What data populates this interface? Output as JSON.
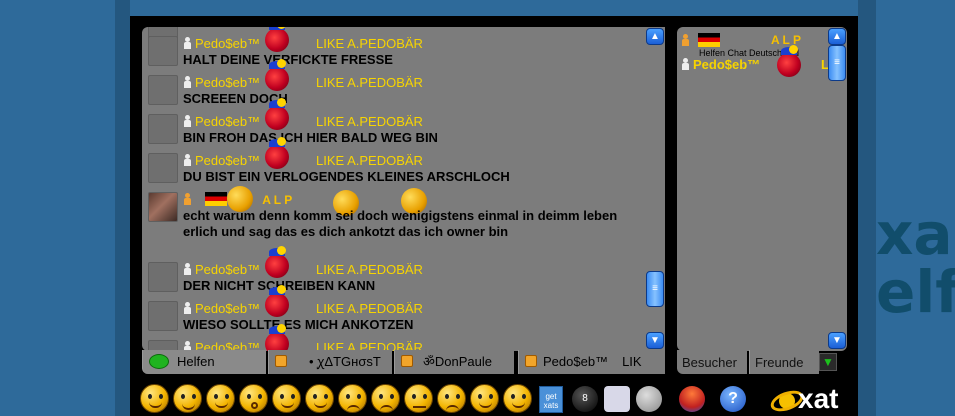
{
  "chat": {
    "messages": [
      {
        "user": "Pedo$eb™",
        "status": "LIKE A.PEDOBÄR",
        "text": "HALT DEINE VERFICKTE FRESSE"
      },
      {
        "user": "Pedo$eb™",
        "status": "LIKE A.PEDOBÄR",
        "text": "SCREEEN DOCH"
      },
      {
        "user": "Pedo$eb™",
        "status": "LIKE A.PEDOBÄR",
        "text": "BIN FROH DAS ICH HIER BALD WEG BIN"
      },
      {
        "user": "Pedo$eb™",
        "status": "LIKE A.PEDOBÄR",
        "text": "DU BIST EIN VERLOGENDES KLEINES ARSCHLOCH"
      },
      {
        "user": "",
        "status": "A L P",
        "text": "echt warum denn     komm sei  doch wenigigstens einmal in deimm leben erlich  und sag das es dich ankotzt das ich owner bin"
      },
      {
        "user": "Pedo$eb™",
        "status": "LIKE A.PEDOBÄR",
        "text": "DER NICHT SCHREIBEN KANN"
      },
      {
        "user": "Pedo$eb™",
        "status": "LIKE A.PEDOBÄR",
        "text": "WIESO SOLLTE ES MICH ANKOTZEN"
      },
      {
        "user": "Pedo$eb™",
        "status": "LIKE A.PEDOBÄR",
        "text": ""
      }
    ],
    "scroll_up": "▲",
    "scroll_down": "▼",
    "scroll_grip": "≡"
  },
  "tabs": [
    {
      "label": "Helfen",
      "icon": "speech-bubble-icon"
    },
    {
      "label": "• ꭕΔTGнσѕT",
      "icon": "lock-icon"
    },
    {
      "label": "ॐDonPaule",
      "icon": "lock-icon"
    },
    {
      "label": "Pedo$eb™",
      "icon": "lock-icon"
    },
    {
      "label": "LIK",
      "icon": ""
    }
  ],
  "visitors": {
    "header_text": "Helfen Chat  Deutschland",
    "header_letters": "A L P",
    "users": [
      {
        "name": "Pedo$eb™",
        "status": "L"
      }
    ],
    "tab_visitors": "Besucher",
    "tab_friends": "Freunde",
    "menu_arrow": "▼"
  },
  "toolbar": {
    "get_xats": "get xats",
    "help": "?",
    "logo": "xat"
  },
  "colors": {
    "page_bg": "#2e6a9a",
    "panel_bg": "#7c7c7c",
    "username": "#f7d400",
    "accent_blue": "#1b5fd6"
  }
}
